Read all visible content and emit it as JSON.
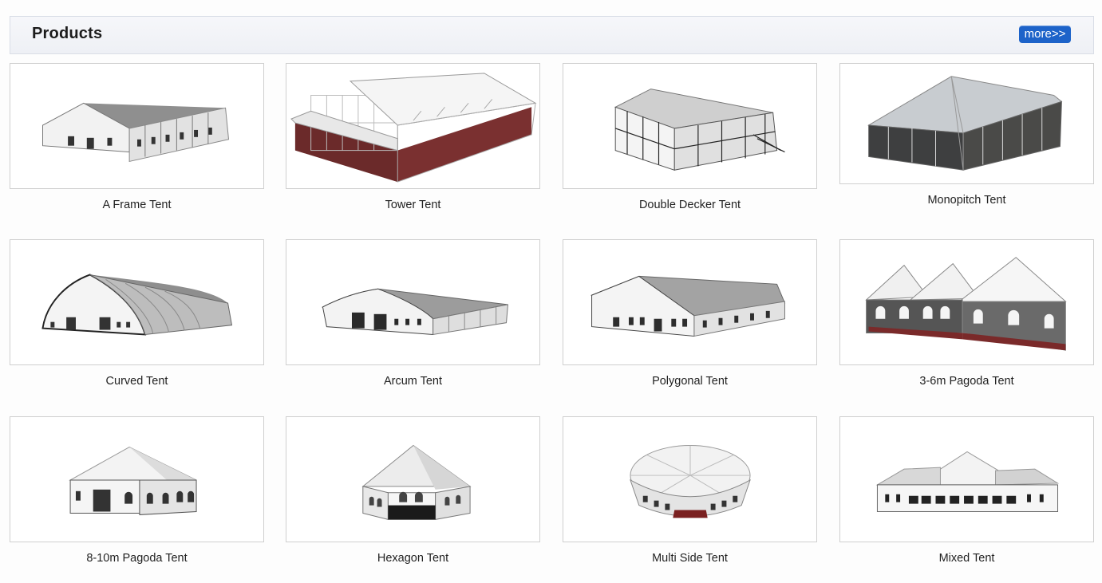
{
  "header": {
    "title": "Products",
    "more_label": "more>>"
  },
  "products": [
    {
      "name": "A Frame Tent",
      "icon": "a-frame-tent-image"
    },
    {
      "name": "Tower Tent",
      "icon": "tower-tent-image"
    },
    {
      "name": "Double Decker Tent",
      "icon": "double-decker-tent-image"
    },
    {
      "name": "Monopitch Tent",
      "icon": "monopitch-tent-image"
    },
    {
      "name": "Curved Tent",
      "icon": "curved-tent-image"
    },
    {
      "name": "Arcum Tent",
      "icon": "arcum-tent-image"
    },
    {
      "name": "Polygonal Tent",
      "icon": "polygonal-tent-image"
    },
    {
      "name": "3-6m Pagoda Tent",
      "icon": "pagoda-3-6m-tent-image"
    },
    {
      "name": "8-10m Pagoda Tent",
      "icon": "pagoda-8-10m-tent-image"
    },
    {
      "name": "Hexagon Tent",
      "icon": "hexagon-tent-image"
    },
    {
      "name": "Multi Side Tent",
      "icon": "multi-side-tent-image"
    },
    {
      "name": "Mixed Tent",
      "icon": "mixed-tent-image"
    }
  ]
}
